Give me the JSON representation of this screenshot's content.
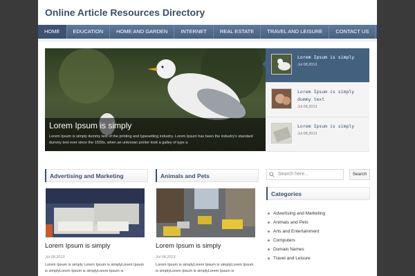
{
  "site": {
    "title": "Online Article Resources Directory"
  },
  "nav": {
    "items": [
      "HOME",
      "EDUCATION",
      "HOME AND GARDEN",
      "INTERNET",
      "REAL ESTATE",
      "TRAVEL AND LEISURE",
      "CONTACT US"
    ]
  },
  "slider": {
    "title": "Lorem Ipsum is simply",
    "text": "Lorem Ipsum is simply dummy text of the printing and typesetting industry. Lorem Ipsum has been the industry's standard dummy text ever since the 1500s, when an unknown printer took a galley of type a"
  },
  "thumbs": [
    {
      "title": "Lorem Ipsum is simply",
      "date": "Jul 08,2013"
    },
    {
      "title": "Lorem Ipsum is simply dummy text",
      "date": "Jul 08,2013"
    },
    {
      "title": "Lorem Ipsum is simply",
      "date": "Jul 08,2013"
    }
  ],
  "sections": [
    {
      "title": "Advertising and Marketing",
      "post_title": "Lorem Ipsum is simply",
      "date": "Jul 08,2013",
      "text": "Lorem Ipsum is simply Lorem Ipsum is simplyLorem Ipsum is simplyLorem Ipsum is simplyLorem Ipsum is"
    },
    {
      "title": "Animals and Pets",
      "post_title": "Lorem Ipsum is simply",
      "date": "Jul 08,2013",
      "text": "Lorem Ipsum is simplyLorem Ipsum is simplyLorem Ipsum is simplyLorem Ipsum is simplyLorem Ipsum is"
    }
  ],
  "search": {
    "placeholder": "Search here...",
    "button": "Search"
  },
  "categories": {
    "title": "Categories",
    "items": [
      "Advertising and Marketing",
      "Animals and Pets",
      "Arts and Entertainment",
      "Computers",
      "Domain Names",
      "Travel and Leisure"
    ]
  }
}
